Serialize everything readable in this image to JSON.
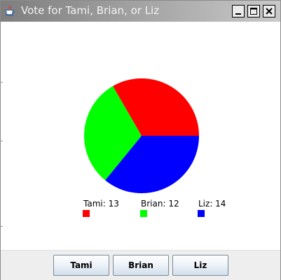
{
  "window": {
    "title": "Vote for Tami, Brian, or Liz",
    "icon": "java-coffee-cup-icon",
    "controls": [
      "minimize-icon",
      "maximize-icon",
      "close-icon"
    ]
  },
  "chart_data": {
    "type": "pie",
    "categories": [
      "Tami",
      "Brian",
      "Liz"
    ],
    "values": [
      13,
      12,
      14
    ],
    "colors": [
      "#ff0000",
      "#00ff00",
      "#0000ff"
    ],
    "legend_labels": [
      "Tami: 13",
      "Brian: 12",
      "Liz: 14"
    ],
    "start_angle_deg": 0,
    "direction": "counterclockwise",
    "legend_position": "bottom"
  },
  "buttons": {
    "tami": "Tami",
    "brian": "Brian",
    "liz": "Liz"
  }
}
